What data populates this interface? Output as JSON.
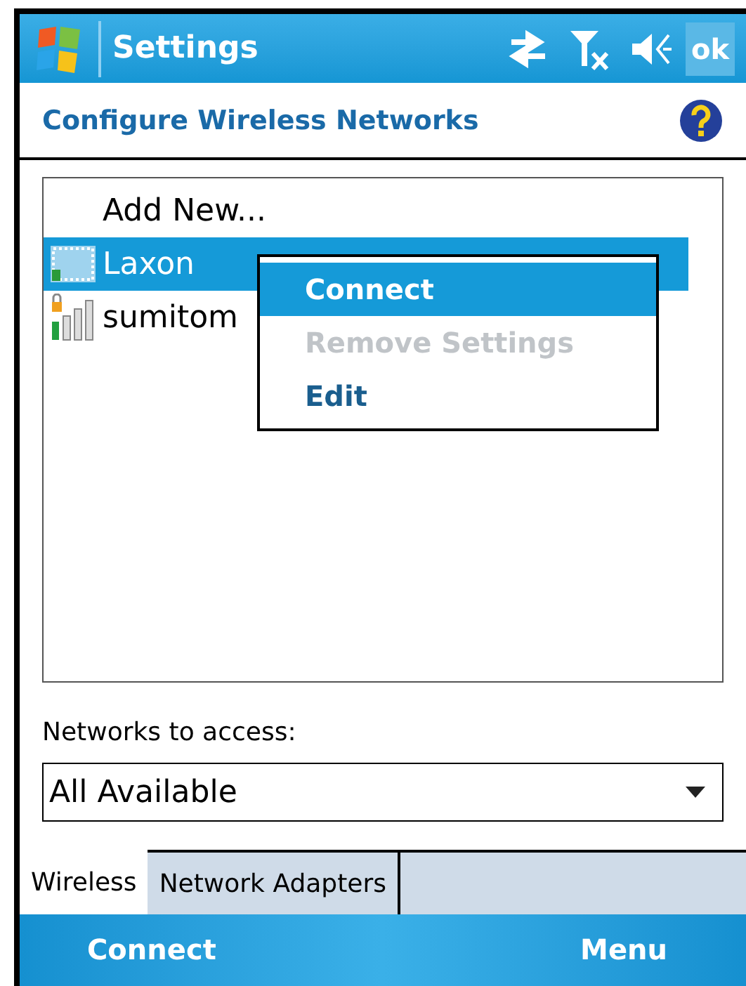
{
  "title_bar": {
    "title": "Settings",
    "ok": "ok"
  },
  "header": {
    "title": "Configure Wireless Networks"
  },
  "networks": [
    {
      "name": "Add New...",
      "kind": "add",
      "selected": false
    },
    {
      "name": "Laxon",
      "kind": "adhoc",
      "selected": true
    },
    {
      "name": "sumitom",
      "kind": "secured",
      "selected": false
    }
  ],
  "context_menu": [
    {
      "label": "Connect",
      "selected": true,
      "disabled": false
    },
    {
      "label": "Remove Settings",
      "selected": false,
      "disabled": true
    },
    {
      "label": "Edit",
      "selected": false,
      "disabled": false
    }
  ],
  "access": {
    "label": "Networks to access:",
    "value": "All Available"
  },
  "tabs": [
    {
      "label": "Wireless",
      "selected": true
    },
    {
      "label": "Network Adapters",
      "selected": false
    }
  ],
  "softkeys": {
    "left": "Connect",
    "right": "Menu"
  }
}
